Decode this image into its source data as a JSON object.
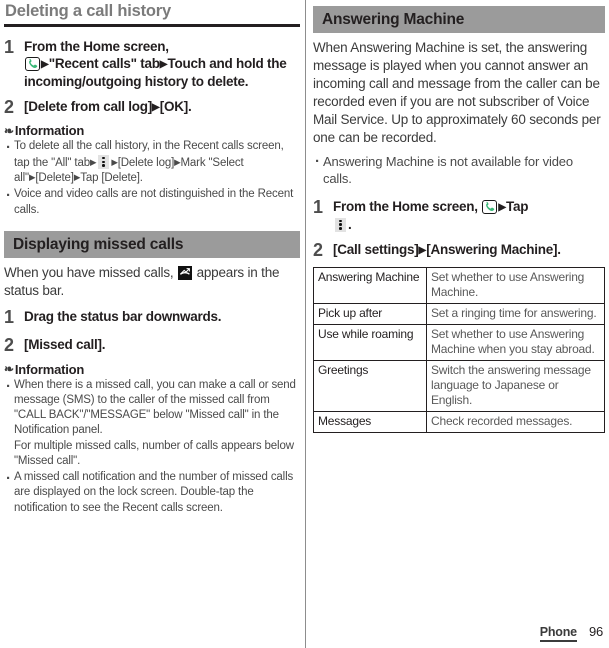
{
  "left": {
    "heading": "Deleting a call history",
    "steps": [
      {
        "num": "1",
        "parts": {
          "a": "From the Home screen,",
          "b": "\"Recent calls\" tab",
          "c": "Touch and hold the incoming/outgoing history to delete."
        }
      },
      {
        "num": "2",
        "parts": {
          "a": "[Delete from call log]",
          "b": "[OK]."
        }
      }
    ],
    "info_label": "Information",
    "info_bullets": [
      {
        "a": "To delete all the call history, in the Recent calls screen, tap the \"All\" tab",
        "b": "[Delete log]",
        "c": "Mark \"Select all\"",
        "d": "[Delete]",
        "e": "Tap [Delete]."
      },
      {
        "a": "Voice and video calls are not distinguished in the Recent calls."
      }
    ],
    "section2": {
      "heading": "Displaying missed calls",
      "intro_a": "When you have missed calls,",
      "intro_b": "appears in the status bar.",
      "steps": [
        {
          "num": "1",
          "text": "Drag the status bar downwards."
        },
        {
          "num": "2",
          "text": "[Missed call]."
        }
      ],
      "info_label": "Information",
      "info_bullets": [
        "When there is a missed call, you can make a call or send message (SMS) to the caller of the missed call from \"CALL BACK\"/\"MESSAGE\" below \"Missed call\" in the Notification panel.\nFor multiple missed calls, number of calls appears below \"Missed call\".",
        "A missed call notification and the number of missed calls are displayed on the lock screen. Double-tap the notification to see the Recent calls screen."
      ]
    }
  },
  "right": {
    "heading": "Answering Machine",
    "intro": "When Answering Machine is set, the answering message is played when you cannot answer an incoming call and message from the caller can be recorded even if you are not subscriber of Voice Mail Service. Up to approximately 60 seconds per one can be recorded.",
    "note_bullets": [
      "Answering Machine is not available for video calls."
    ],
    "steps": [
      {
        "num": "1",
        "parts": {
          "a": "From the Home screen,",
          "b": "Tap",
          "c": "."
        }
      },
      {
        "num": "2",
        "parts": {
          "a": "[Call settings]",
          "b": "[Answering Machine]."
        }
      }
    ],
    "table": {
      "rows": [
        {
          "key": "Answering Machine",
          "value": "Set whether to use Answering Machine."
        },
        {
          "key": "Pick up after",
          "value": "Set a ringing time for answering."
        },
        {
          "key": "Use while roaming",
          "value": "Set whether to use Answering Machine when you stay abroad."
        },
        {
          "key": "Greetings",
          "value": "Switch the answering message language to Japanese or English."
        },
        {
          "key": "Messages",
          "value": "Check recorded messages."
        }
      ]
    }
  },
  "footer": {
    "chapter": "Phone",
    "page": "96"
  },
  "colors": {
    "section_bar": "#9b9b9b",
    "heading_text": "#7b7b7b",
    "body_text": "#3b3b3b",
    "phone_icon_green": "#3bb878"
  }
}
